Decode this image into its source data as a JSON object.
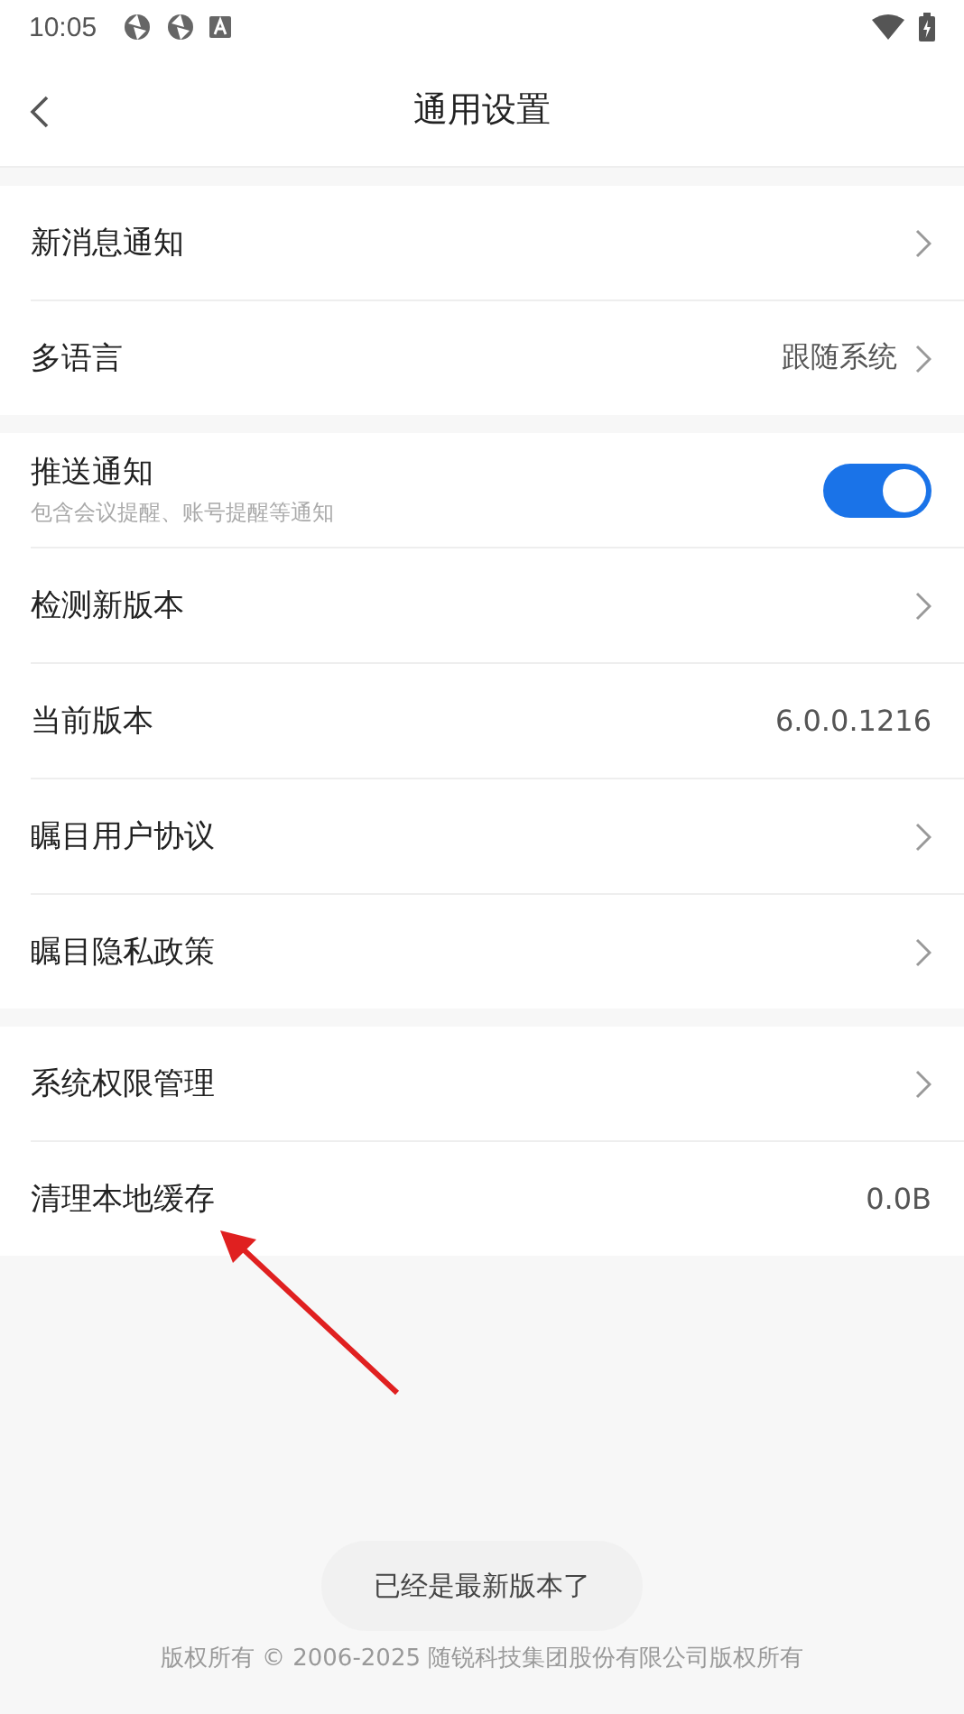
{
  "status_bar": {
    "time": "10:05"
  },
  "header": {
    "title": "通用设置"
  },
  "groups": [
    {
      "items": [
        {
          "kind": "link",
          "label": "新消息通知"
        },
        {
          "kind": "link",
          "label": "多语言",
          "value": "跟随系统"
        }
      ]
    },
    {
      "items": [
        {
          "kind": "toggle",
          "label": "推送通知",
          "description": "包含会议提醒、账号提醒等通知",
          "on": true
        },
        {
          "kind": "link",
          "label": "检测新版本"
        },
        {
          "kind": "value",
          "label": "当前版本",
          "value": "6.0.0.1216"
        },
        {
          "kind": "link",
          "label": "瞩目用户协议"
        },
        {
          "kind": "link",
          "label": "瞩目隐私政策"
        }
      ]
    },
    {
      "items": [
        {
          "kind": "link",
          "label": "系统权限管理"
        },
        {
          "kind": "value",
          "label": "清理本地缓存",
          "value": "0.0B"
        }
      ]
    }
  ],
  "footer": {
    "copyright": "版权所有 © 2006-2025 随锐科技集团股份有限公司版权所有"
  },
  "toast": {
    "message": "已经是最新版本了"
  }
}
